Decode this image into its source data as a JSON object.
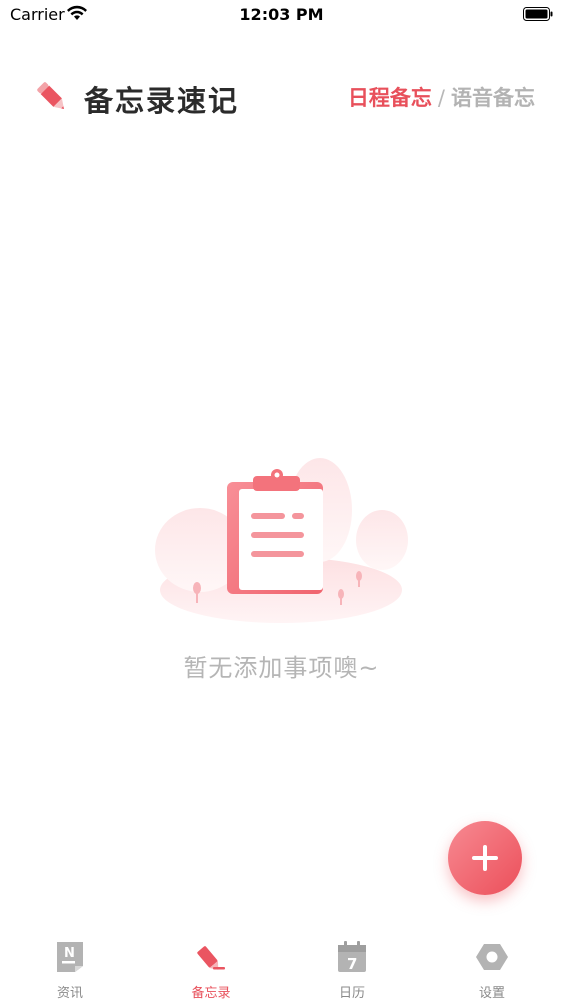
{
  "status_bar": {
    "carrier": "Carrier",
    "time": "12:03 PM"
  },
  "header": {
    "title": "备忘录速记",
    "tabs": {
      "active": "日程备忘",
      "separator": "/",
      "inactive": "语音备忘"
    }
  },
  "empty_state": {
    "message": "暂无添加事项噢~"
  },
  "tab_bar": {
    "items": [
      {
        "label": "资讯",
        "icon": "news-icon"
      },
      {
        "label": "备忘录",
        "icon": "memo-icon"
      },
      {
        "label": "日历",
        "icon": "calendar-icon",
        "badge": "7"
      },
      {
        "label": "设置",
        "icon": "settings-icon"
      }
    ],
    "active_index": 1
  },
  "colors": {
    "accent": "#e8505b",
    "inactive": "#8a8a8a"
  }
}
